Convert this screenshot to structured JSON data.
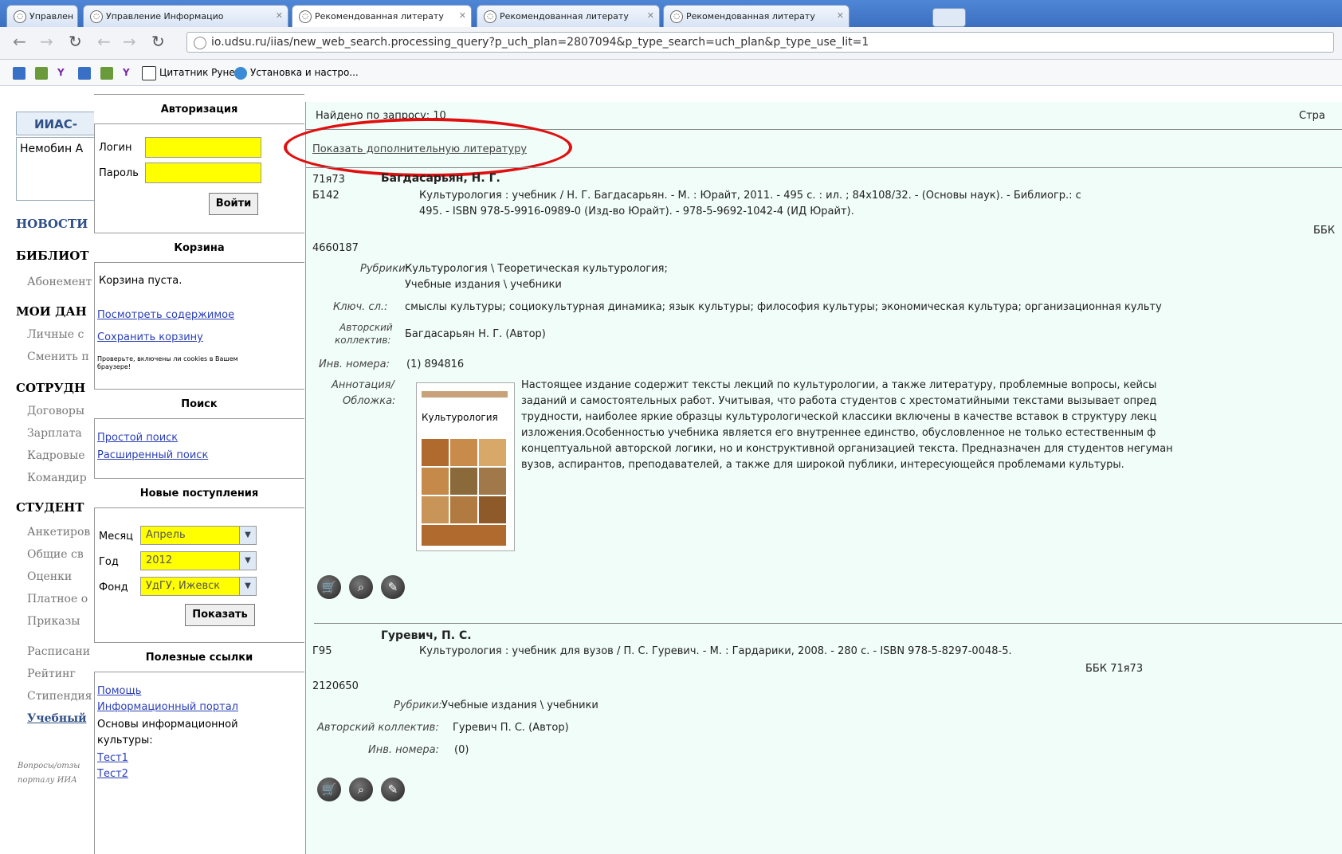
{
  "tabs": [
    {
      "label": "Управлен"
    },
    {
      "label": "Управление Информацио"
    },
    {
      "label": "Рекомендованная литерату"
    },
    {
      "label": "Рекомендованная литерату"
    },
    {
      "label": "Рекомендованная литерату"
    }
  ],
  "address": "io.udsu.ru/iias/new_web_search.processing_query?p_uch_plan=2807094&p_type_search=uch_plan&p_type_use_lit=1",
  "bookmarks": {
    "citatnik": "Цитатник Рунета",
    "install": "Установка и настро..."
  },
  "left": {
    "iias": "ИИАС-",
    "user": "Немобин А",
    "news": "НОВОСТИ",
    "library": "БИБЛИОТ",
    "abonement": "Абонемент",
    "mydata": "МОИ ДАН",
    "personal": "Личные с",
    "change": "Сменить п",
    "staff": "СОТРУДН",
    "contracts": "Договоры",
    "salary": "Зарплата",
    "hr": "Кадровые",
    "trips": "Командир",
    "student": "СТУДЕНТ",
    "survey": "Анкетиров",
    "common": "Общие св",
    "grades": "Оценки",
    "paid": "Платное о",
    "orders": "Приказы",
    "schedule": "Расписани",
    "rating": "Рейтинг",
    "stipend": "Стипендия",
    "study": "Учебный",
    "questions": "Вопросы/отзы",
    "portal": "порталу ИИА"
  },
  "panel": {
    "auth_title": "Авторизация",
    "login_label": "Логин",
    "password_label": "Пароль",
    "login_button": "Войти",
    "cart_title": "Корзина",
    "cart_empty": "Корзина пуста.",
    "view_contents": "Посмотреть содержимое",
    "save_cart": "Сохранить корзину",
    "cookie_note": "Проверьте, включены ли cookies в Вашем браузере!",
    "search_title": "Поиск",
    "simple_search": "Простой поиск",
    "advanced_search": "Расширенный поиск",
    "new_title": "Новые поступления",
    "month_label": "Месяц",
    "month_value": "Апрель",
    "year_label": "Год",
    "year_value": "2012",
    "fund_label": "Фонд",
    "fund_value": "УдГУ, Ижевск",
    "show_button": "Показать",
    "links_title": "Полезные ссылки",
    "help": "Помощь",
    "info_portal": "Информационный портал",
    "basics_1": "Основы информационной",
    "basics_2": "культуры:",
    "test1": "Тест1",
    "test2": "Тест2"
  },
  "main": {
    "found": "Найдено по запросу: 10",
    "page_label": "Стра",
    "show_more": "Показать дополнительную литературу",
    "r1": {
      "code": "71я73",
      "author": "Багдасарьян, Н. Г.",
      "shelf": "Б142",
      "line1": "Культурология : учебник / Н. Г. Багдасарьян. - М. : Юрайт, 2011. - 495 с. : ил. ; 84х108/32. - (Основы наук). - Библиогр.: с",
      "line2": "495. - ISBN 978-5-9916-0989-0 (Изд-во Юрайт). - 978-5-9692-1042-4 (ИД Юрайт).",
      "bbk": "ББК",
      "id": "4660187",
      "rubrics_label": "Рубрики:",
      "rubrics_1": "Культурология \\ Теоретическая культурология;",
      "rubrics_2": "Учебные издания \\ учебники",
      "keys_label": "Ключ. сл.:",
      "keys": "смыслы культуры; социокультурная динамика; язык культуры; философия культуры; экономическая культура; организационная культу",
      "authors_label_1": "Авторский",
      "authors_label_2": "коллектив:",
      "authors": "Багдасарьян Н. Г. (Автор)",
      "inv_label": "Инв. номера:",
      "inv": "(1) 894816",
      "annot_label_1": "Аннотация/",
      "annot_label_2": "Обложка:",
      "cover_title": "Культурология",
      "annot": [
        "Настоящее издание содержит тексты лекций по культурологии, а также литературу, проблемные вопросы, кейсы",
        "заданий и самостоятельных работ. Учитывая, что работа студентов с хрестоматийными текстами вызывает опред",
        "трудности, наиболее яркие образцы культурологической классики включены в качестве вставок в структуру лекц",
        "изложения.Особенностью учебника является его внутреннее единство, обусловленное не только естественным ф",
        "концептуальной авторской логики, но и конструктивной организацией текста. Предназначен для студентов негуман",
        "вузов, аспирантов, преподавателей, а также для широкой публики, интересующейся проблемами культуры."
      ]
    },
    "r2": {
      "author": "Гуревич, П. С.",
      "shelf": "Г95",
      "line1": "Культурология : учебник для вузов / П. С. Гуревич. - М. : Гардарики, 2008. - 280 с. - ISBN 978-5-8297-0048-5.",
      "bbk": "ББК 71я73",
      "id": "2120650",
      "rubrics_label": "Рубрики:",
      "rubrics": "Учебные издания \\ учебники",
      "authors_label": "Авторский коллектив:",
      "authors": "Гуревич П. С. (Автор)",
      "inv_label": "Инв. номера:",
      "inv": "(0)"
    }
  },
  "colors": {
    "highlight_ellipse": "#e01010",
    "input_yellow": "#ffff00",
    "main_bg": "#f1fdf9",
    "link": "#2b3fb5"
  }
}
